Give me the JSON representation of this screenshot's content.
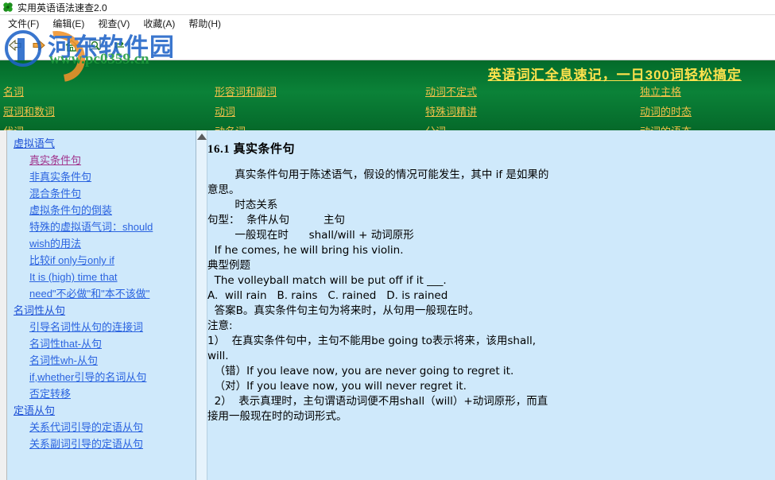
{
  "window": {
    "title": "实用英语语法速查2.0",
    "icon": "clover-icon"
  },
  "menu": {
    "items": [
      {
        "label": "文件(F)",
        "name": "menu-file"
      },
      {
        "label": "编辑(E)",
        "name": "menu-edit"
      },
      {
        "label": "视查(V)",
        "name": "menu-view"
      },
      {
        "label": "收藏(A)",
        "name": "menu-favorites"
      },
      {
        "label": "帮助(H)",
        "name": "menu-help"
      }
    ]
  },
  "toolbar": {
    "buttons": [
      {
        "name": "back-button",
        "icon": "arrow-left-icon"
      },
      {
        "name": "forward-button",
        "icon": "arrow-right-icon"
      },
      {
        "name": "home-button",
        "icon": "home-icon"
      },
      {
        "name": "search-button",
        "icon": "search-icon"
      },
      {
        "name": "refresh-button",
        "icon": "refresh-icon"
      }
    ]
  },
  "watermark": {
    "brand_cn": "河东软件园",
    "url": "www.pc0359.cn",
    "logo_color": "#1f64c8",
    "url_color": "#1e9a3c"
  },
  "banner": {
    "slogan": "英语词汇全息速记，一日300词轻松搞定",
    "slogan_color": "#ffe24d",
    "background_color": "#0a7a33"
  },
  "nav": {
    "link_color": "#f2c14a",
    "rows": [
      [
        "名词",
        "形容词和副词",
        "动词不定式",
        "独立主格"
      ],
      [
        "冠词和数词",
        "动词",
        "特殊词精讲",
        "动词的时态"
      ],
      [
        "代词",
        "动名词",
        "分词",
        "动词的语态"
      ]
    ]
  },
  "sidebar": {
    "background_color": "#cfe9fb",
    "link_color": "#2a63e0",
    "visited_color": "#a0338c",
    "items": [
      {
        "label": "虚拟语气",
        "level": 0,
        "visited": false
      },
      {
        "label": "真实条件句",
        "level": 1,
        "visited": true
      },
      {
        "label": "非真实条件句",
        "level": 1,
        "visited": false
      },
      {
        "label": "混合条件句",
        "level": 1,
        "visited": false
      },
      {
        "label": "虚拟条件句的倒装",
        "level": 1,
        "visited": false
      },
      {
        "label": "特殊的虚拟语气词：should",
        "level": 1,
        "visited": false
      },
      {
        "label": "wish的用法",
        "level": 1,
        "visited": false
      },
      {
        "label": "比较if only与only if",
        "level": 1,
        "visited": false
      },
      {
        "label": "It is (high) time that",
        "level": 1,
        "visited": false
      },
      {
        "label": "need\"不必做\"和\"本不该做\"",
        "level": 1,
        "visited": false
      },
      {
        "label": "名词性从句",
        "level": 0,
        "visited": false
      },
      {
        "label": "引导名词性从句的连接词",
        "level": 1,
        "visited": false
      },
      {
        "label": "名词性that-从句",
        "level": 1,
        "visited": false
      },
      {
        "label": "名词性wh-从句",
        "level": 1,
        "visited": false
      },
      {
        "label": "if,whether引导的名词从句",
        "level": 1,
        "visited": false
      },
      {
        "label": "否定转移",
        "level": 1,
        "visited": false
      },
      {
        "label": "定语从句",
        "level": 0,
        "visited": false
      },
      {
        "label": "关系代词引导的定语从句",
        "level": 1,
        "visited": false
      },
      {
        "label": "关系副词引导的定语从句",
        "level": 1,
        "visited": false
      }
    ]
  },
  "document": {
    "heading": "16.1  真实条件句",
    "intro": "        真实条件句用于陈述语气，假设的情况可能发生，其中 if 是如果的\n意思。",
    "tense_title": "        时态关系",
    "pattern_line1": "句型：  条件从句          主句",
    "pattern_line2": "        一般现在时      shall/will + 动词原形",
    "pattern_example": "  If he comes, he will bring his violin.",
    "example_title": "典型例题",
    "example_question": "  The volleyball match will be put off if it ___.",
    "example_options": "A.  will rain   B. rains   C. rained   D. is rained",
    "example_answer": "  答案B。真实条件句主句为将来时，从句用一般现在时。",
    "note_title": "注意:",
    "note1": "1）  在真实条件句中，主句不能用be going to表示将来，该用shall,\nwill.",
    "note1_wrong": "  （错）If you leave now, you are never going to regret it.",
    "note1_right": "  （对）If you leave now, you will never regret it.",
    "note2": "  2）  表示真理时，主句谓语动词便不用shall（will）+动词原形，而直\n接用一般现在时的动词形式。"
  }
}
